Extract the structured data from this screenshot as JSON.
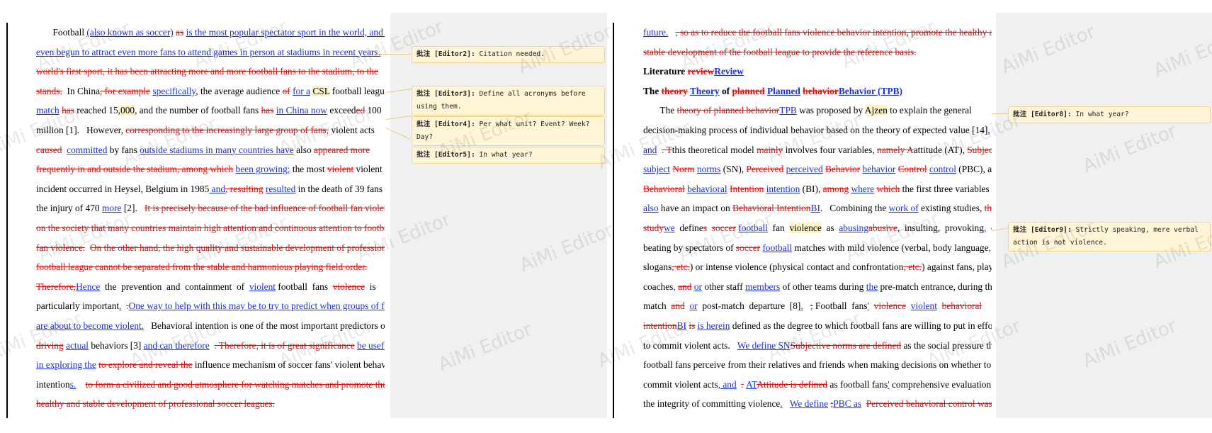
{
  "watermark": "AiMi Editor",
  "colors": {
    "insert": "#1a2fe0",
    "delete": "#e01010",
    "comment_bg": "#fff5d6"
  },
  "comments": [
    {
      "author": "批注 [Editor2]:",
      "text": "Citation needed."
    },
    {
      "author": "批注 [Editor3]:",
      "text": "Define all acronyms before using them."
    },
    {
      "author": "批注 [Editor4]:",
      "text": "Per what unit?  Event?  Week? Day?"
    },
    {
      "author": "批注 [Editor5]:",
      "text": "In what year?"
    },
    {
      "author": "批注 [Editor8]:",
      "text": "In what year?"
    },
    {
      "author": "批注 [Editor9]:",
      "text": "Strictly speaking, mere verbal action is not violence."
    }
  ]
}
